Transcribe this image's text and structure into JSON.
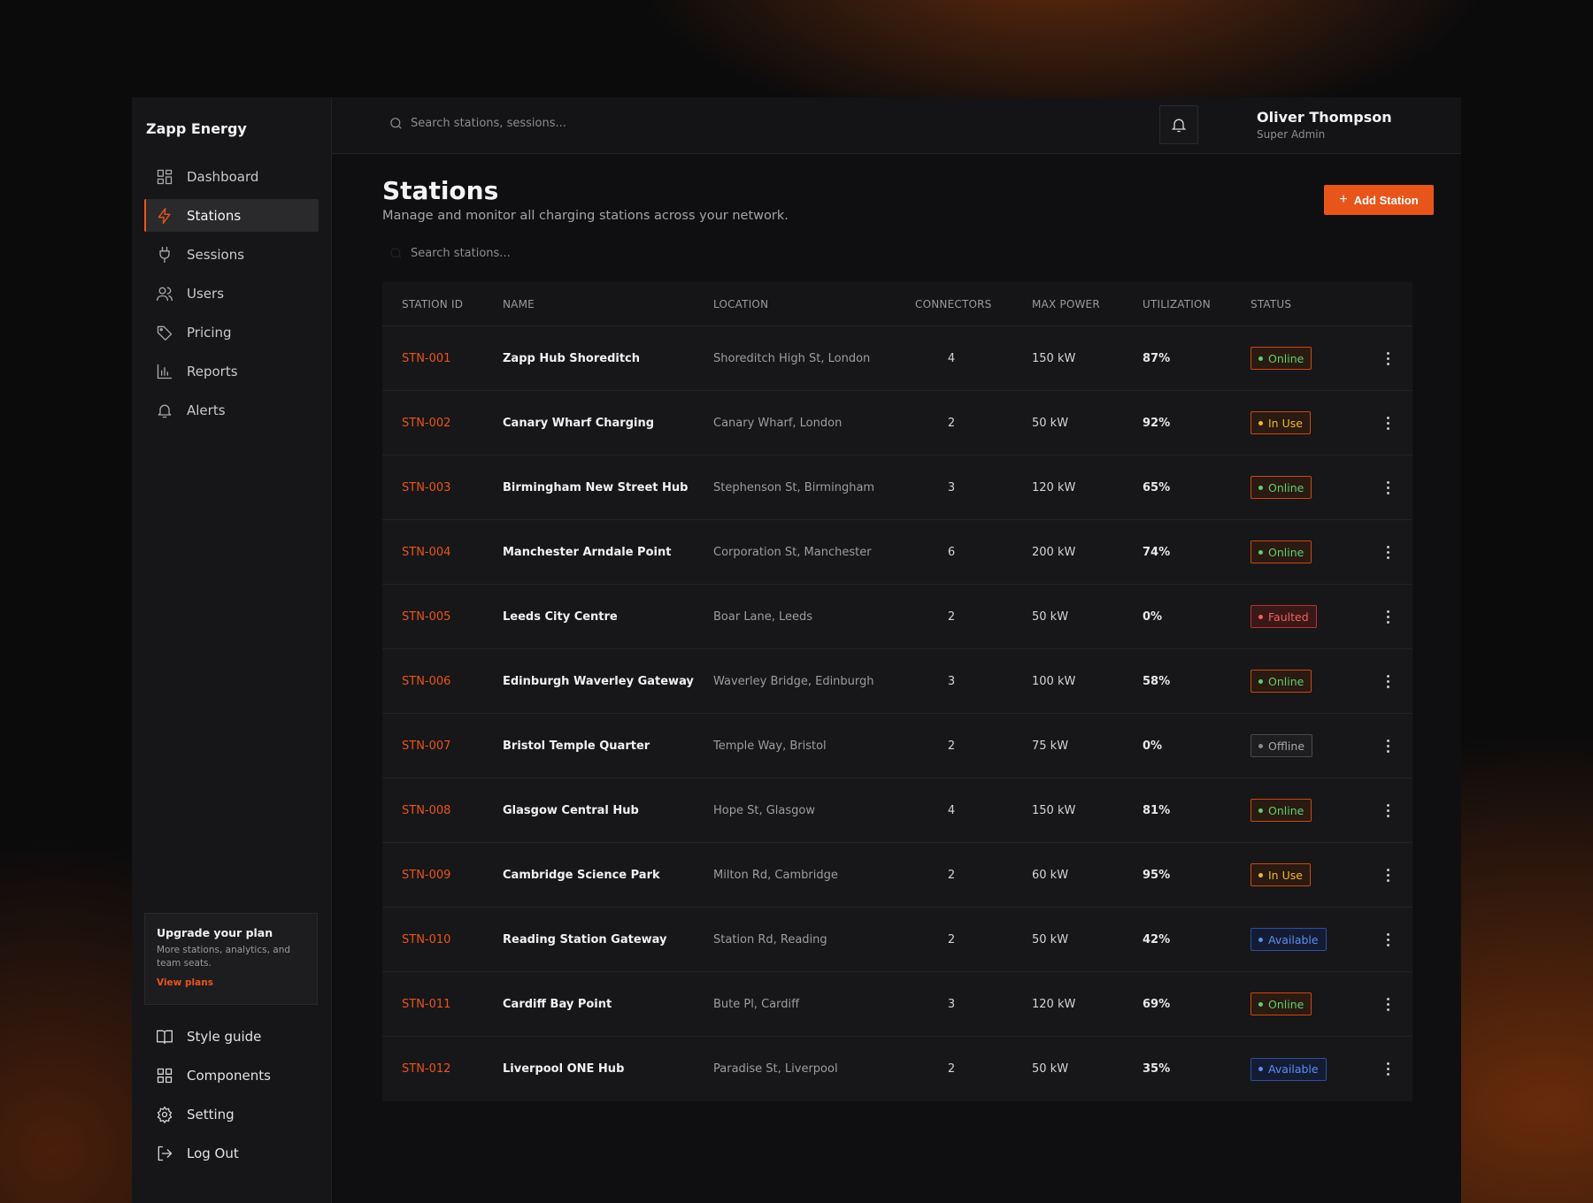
{
  "brand": "Zapp Energy",
  "sidebar": {
    "items": [
      {
        "label": "Dashboard",
        "icon": "dashboard-icon"
      },
      {
        "label": "Stations",
        "icon": "lightning-icon",
        "active": true
      },
      {
        "label": "Sessions",
        "icon": "plug-icon"
      },
      {
        "label": "Users",
        "icon": "users-icon"
      },
      {
        "label": "Pricing",
        "icon": "tag-icon"
      },
      {
        "label": "Reports",
        "icon": "bar-chart-icon"
      },
      {
        "label": "Alerts",
        "icon": "bell-icon"
      }
    ],
    "upgrade": {
      "title": "Upgrade your plan",
      "description": "More stations, analytics, and team seats.",
      "link": "View plans"
    },
    "bottom_items": [
      {
        "label": "Style guide",
        "icon": "book-icon"
      },
      {
        "label": "Components",
        "icon": "grid-icon"
      },
      {
        "label": "Setting",
        "icon": "gear-icon"
      },
      {
        "label": "Log Out",
        "icon": "logout-icon"
      }
    ]
  },
  "topbar": {
    "search_placeholder": "Search stations, sessions...",
    "user_name": "Oliver Thompson",
    "user_role": "Super Admin"
  },
  "page": {
    "title": "Stations",
    "subtitle": "Manage and monitor all charging stations across your network.",
    "add_button": "Add Station",
    "search_placeholder": "Search stations..."
  },
  "table": {
    "headers": [
      "STATION ID",
      "NAME",
      "LOCATION",
      "CONNECTORS",
      "MAX POWER",
      "UTILIZATION",
      "STATUS"
    ],
    "rows": [
      {
        "id": "STN-001",
        "name": "Zapp Hub Shoreditch",
        "location": "Shoreditch High St, London",
        "connectors": "4",
        "power": "150 kW",
        "util": "87%",
        "status": "Online"
      },
      {
        "id": "STN-002",
        "name": "Canary Wharf Charging",
        "location": "Canary Wharf, London",
        "connectors": "2",
        "power": "50 kW",
        "util": "92%",
        "status": "In Use"
      },
      {
        "id": "STN-003",
        "name": "Birmingham New Street Hub",
        "location": "Stephenson St, Birmingham",
        "connectors": "3",
        "power": "120 kW",
        "util": "65%",
        "status": "Online"
      },
      {
        "id": "STN-004",
        "name": "Manchester Arndale Point",
        "location": "Corporation St, Manchester",
        "connectors": "6",
        "power": "200 kW",
        "util": "74%",
        "status": "Online"
      },
      {
        "id": "STN-005",
        "name": "Leeds City Centre",
        "location": "Boar Lane, Leeds",
        "connectors": "2",
        "power": "50 kW",
        "util": "0%",
        "status": "Faulted"
      },
      {
        "id": "STN-006",
        "name": "Edinburgh Waverley Gateway",
        "location": "Waverley Bridge, Edinburgh",
        "connectors": "3",
        "power": "100 kW",
        "util": "58%",
        "status": "Online"
      },
      {
        "id": "STN-007",
        "name": "Bristol Temple Quarter",
        "location": "Temple Way, Bristol",
        "connectors": "2",
        "power": "75 kW",
        "util": "0%",
        "status": "Offline"
      },
      {
        "id": "STN-008",
        "name": "Glasgow Central Hub",
        "location": "Hope St, Glasgow",
        "connectors": "4",
        "power": "150 kW",
        "util": "81%",
        "status": "Online"
      },
      {
        "id": "STN-009",
        "name": "Cambridge Science Park",
        "location": "Milton Rd, Cambridge",
        "connectors": "2",
        "power": "60 kW",
        "util": "95%",
        "status": "In Use"
      },
      {
        "id": "STN-010",
        "name": "Reading Station Gateway",
        "location": "Station Rd, Reading",
        "connectors": "2",
        "power": "50 kW",
        "util": "42%",
        "status": "Available"
      },
      {
        "id": "STN-011",
        "name": "Cardiff Bay Point",
        "location": "Bute Pl, Cardiff",
        "connectors": "3",
        "power": "120 kW",
        "util": "69%",
        "status": "Online"
      },
      {
        "id": "STN-012",
        "name": "Liverpool ONE Hub",
        "location": "Paradise St, Liverpool",
        "connectors": "2",
        "power": "50 kW",
        "util": "35%",
        "status": "Available"
      }
    ]
  },
  "colors": {
    "accent": "#e8551a",
    "online": "#5fd06e",
    "in_use": "#f1b928",
    "faulted": "#ef6060",
    "available": "#5b8ef3",
    "offline": "#a9a9ad"
  }
}
